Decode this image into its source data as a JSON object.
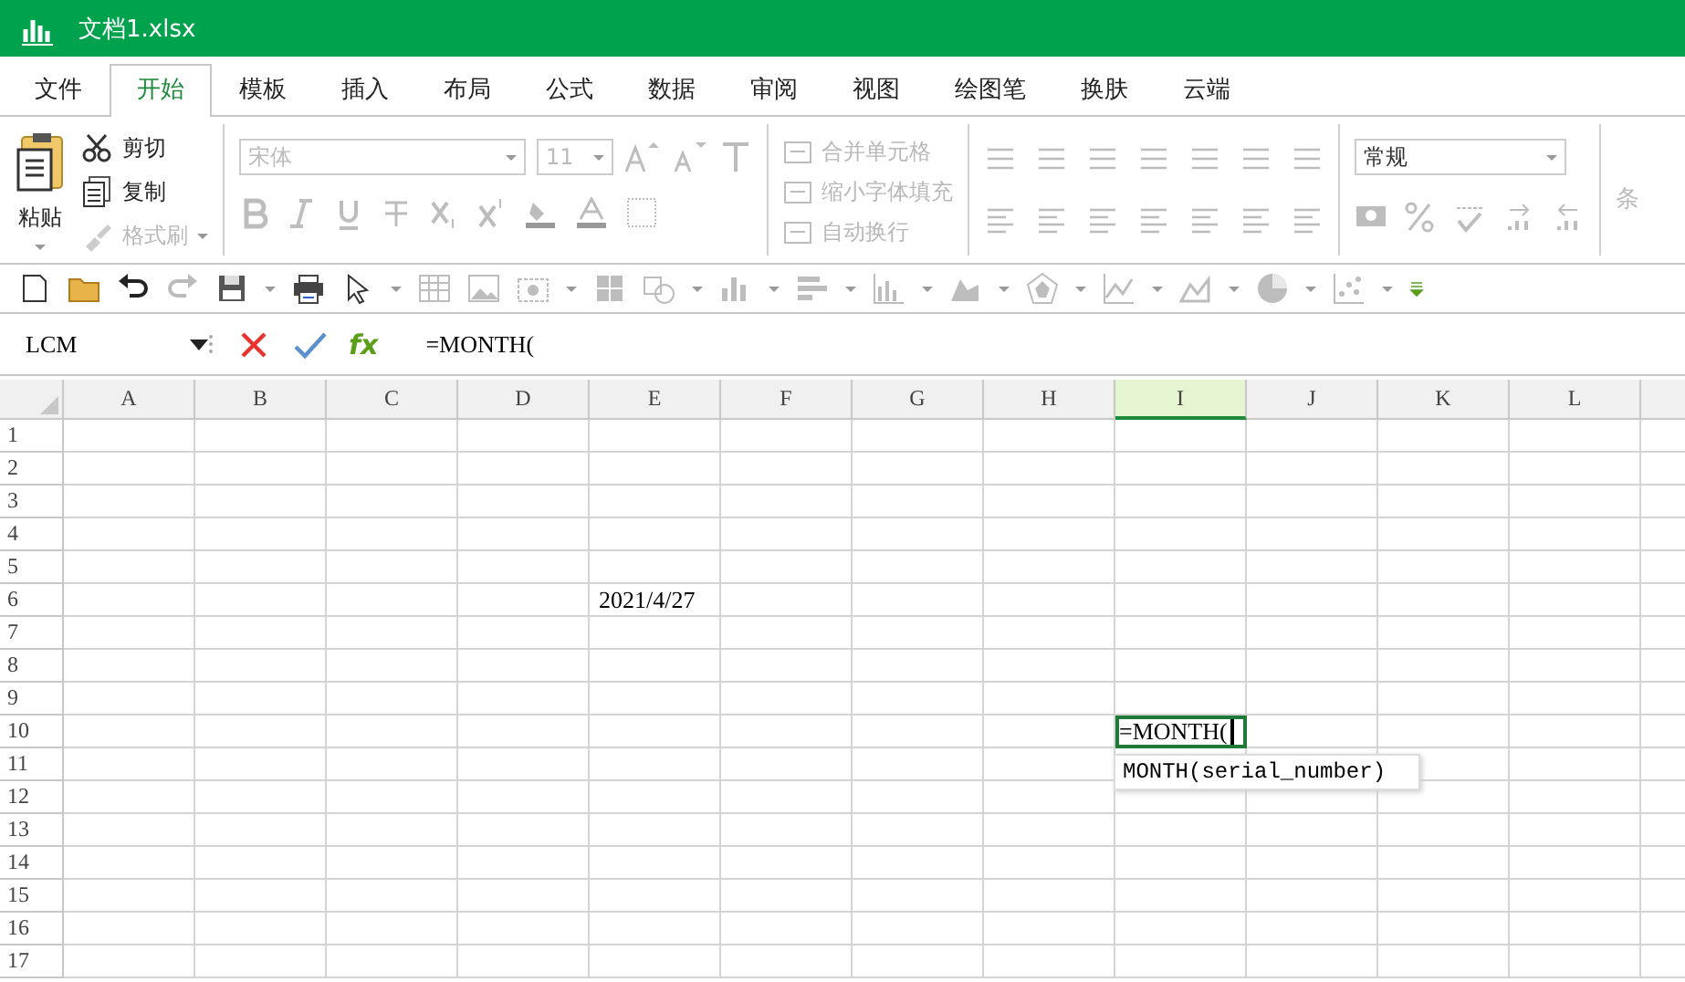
{
  "window": {
    "title": "文档1.xlsx"
  },
  "tabs": [
    {
      "label": "文件",
      "selected": false
    },
    {
      "label": "开始",
      "selected": true
    },
    {
      "label": "模板",
      "selected": false
    },
    {
      "label": "插入",
      "selected": false
    },
    {
      "label": "布局",
      "selected": false
    },
    {
      "label": "公式",
      "selected": false
    },
    {
      "label": "数据",
      "selected": false
    },
    {
      "label": "审阅",
      "selected": false
    },
    {
      "label": "视图",
      "selected": false
    },
    {
      "label": "绘图笔",
      "selected": false
    },
    {
      "label": "换肤",
      "selected": false
    },
    {
      "label": "云端",
      "selected": false
    }
  ],
  "ribbon": {
    "paste": {
      "label": "粘贴",
      "disabled": false
    },
    "clipboard": [
      {
        "kind": "cut",
        "label": "剪切",
        "disabled": false
      },
      {
        "kind": "copy",
        "label": "复制",
        "disabled": false
      },
      {
        "kind": "painter",
        "label": "格式刷",
        "disabled": true
      }
    ],
    "font_name": "宋体",
    "font_size": "11",
    "alignment": [
      {
        "label": "合并单元格",
        "disabled": true
      },
      {
        "label": "缩小字体填充",
        "disabled": true
      },
      {
        "label": "自动换行",
        "disabled": true
      }
    ],
    "number_format": "常规",
    "cut_off_label": "条"
  },
  "formula_bar": {
    "name_box": "LCM",
    "function_button": "fx",
    "formula": "=MONTH("
  },
  "grid": {
    "columns": [
      {
        "label": "A",
        "selected": false
      },
      {
        "label": "B",
        "selected": false
      },
      {
        "label": "C",
        "selected": false
      },
      {
        "label": "D",
        "selected": false
      },
      {
        "label": "E",
        "selected": false
      },
      {
        "label": "F",
        "selected": false
      },
      {
        "label": "G",
        "selected": false
      },
      {
        "label": "H",
        "selected": false
      },
      {
        "label": "I",
        "selected": true
      },
      {
        "label": "J",
        "selected": false
      },
      {
        "label": "K",
        "selected": false
      },
      {
        "label": "L",
        "selected": false
      }
    ],
    "rows": [
      {
        "label": "1",
        "selected": false
      },
      {
        "label": "2",
        "selected": false
      },
      {
        "label": "3",
        "selected": false
      },
      {
        "label": "4",
        "selected": false
      },
      {
        "label": "5",
        "selected": false
      },
      {
        "label": "6",
        "selected": false,
        "cells": {
          "E": {
            "value": "2021/4/27",
            "editing": false
          }
        }
      },
      {
        "label": "7",
        "selected": false
      },
      {
        "label": "8",
        "selected": false
      },
      {
        "label": "9",
        "selected": false
      },
      {
        "label": "10",
        "selected": false,
        "cells": {
          "I": {
            "value": "=MONTH(",
            "editing": true,
            "tooltip": "MONTH(serial_number)"
          }
        }
      },
      {
        "label": "11",
        "selected": false
      },
      {
        "label": "12",
        "selected": false
      },
      {
        "label": "13",
        "selected": false
      },
      {
        "label": "14",
        "selected": false
      },
      {
        "label": "15",
        "selected": false
      },
      {
        "label": "16",
        "selected": false
      },
      {
        "label": "17",
        "selected": false
      }
    ]
  }
}
